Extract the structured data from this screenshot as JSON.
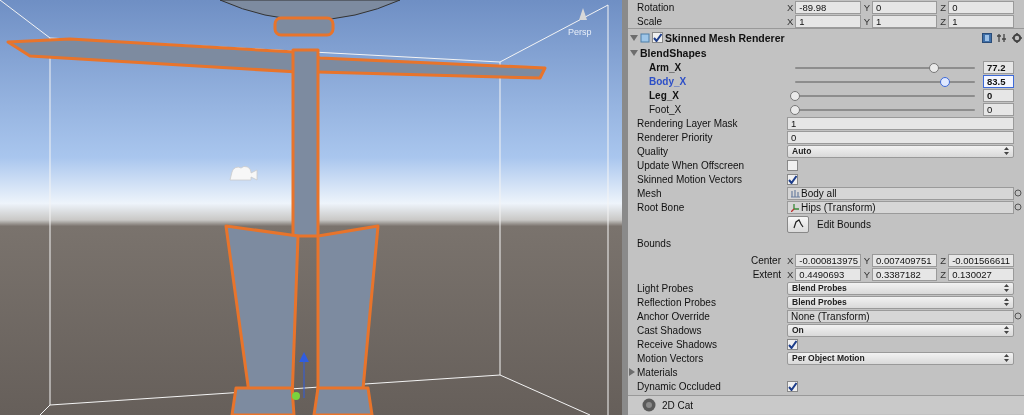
{
  "scene": {
    "view_label": "Persp"
  },
  "transform": [
    {
      "label": "Rotation",
      "fields": [
        {
          "axis": "X",
          "value": "-89.98"
        },
        {
          "axis": "Y",
          "value": "0"
        },
        {
          "axis": "Z",
          "value": "0"
        }
      ]
    },
    {
      "label": "Scale",
      "fields": [
        {
          "axis": "X",
          "value": "1"
        },
        {
          "axis": "Y",
          "value": "1"
        },
        {
          "axis": "Z",
          "value": "1"
        }
      ]
    }
  ],
  "component": {
    "title": "Skinned Mesh Renderer",
    "enabled": true,
    "expanded": true
  },
  "blend_shapes": {
    "label": "BlendShapes",
    "expanded": true,
    "items": [
      {
        "name": "Arm_X",
        "level": 0.772,
        "value": "77.2",
        "selected": false,
        "overridden": true
      },
      {
        "name": "Body_X",
        "level": 0.835,
        "value": "83.5",
        "selected": true,
        "overridden": true
      },
      {
        "name": "Leg_X",
        "level": 0,
        "value": "0",
        "selected": false,
        "overridden": true
      },
      {
        "name": "Foot_X",
        "level": 0,
        "value": "0",
        "selected": false,
        "overridden": false
      }
    ]
  },
  "properties": [
    {
      "kind": "text",
      "label": "Rendering Layer Mask",
      "value": "1"
    },
    {
      "kind": "text",
      "label": "Renderer Priority",
      "value": "0"
    },
    {
      "kind": "dropdown",
      "label": "Quality",
      "value": "Auto"
    },
    {
      "kind": "checkbox",
      "label": "Update When Offscreen",
      "checked": false
    },
    {
      "kind": "checkbox",
      "label": "Skinned Motion Vectors",
      "checked": true
    },
    {
      "kind": "mesh_object",
      "label": "Mesh",
      "value": "Body all"
    },
    {
      "kind": "bone_object",
      "label": "Root Bone",
      "value": "Hips (Transform)"
    },
    {
      "kind": "button",
      "value": "Edit Bounds"
    },
    {
      "kind": "header",
      "label": "Bounds"
    },
    {
      "kind": "vector",
      "label": "Center",
      "fields": [
        {
          "axis": "X",
          "value": "-0.000813975"
        },
        {
          "axis": "Y",
          "value": "0.007409751"
        },
        {
          "axis": "Z",
          "value": "-0.001566611"
        }
      ]
    },
    {
      "kind": "vector",
      "label": "Extent",
      "fields": [
        {
          "axis": "X",
          "value": "0.4490693"
        },
        {
          "axis": "Y",
          "value": "0.3387182"
        },
        {
          "axis": "Z",
          "value": "0.130027"
        }
      ]
    },
    {
      "kind": "dropdown",
      "label": "Light Probes",
      "value": "Blend Probes"
    },
    {
      "kind": "dropdown",
      "label": "Reflection Probes",
      "value": "Blend Probes"
    },
    {
      "kind": "object",
      "label": "Anchor Override",
      "value": "None (Transform)"
    },
    {
      "kind": "dropdown",
      "label": "Cast Shadows",
      "value": "On"
    },
    {
      "kind": "checkbox",
      "label": "Receive Shadows",
      "checked": true
    },
    {
      "kind": "dropdown",
      "label": "Motion Vectors",
      "value": "Per Object Motion"
    },
    {
      "kind": "foldout",
      "label": "Materials",
      "expanded": false
    },
    {
      "kind": "checkbox",
      "label": "Dynamic Occluded",
      "checked": true
    }
  ],
  "next_component": {
    "title": "2D Cat"
  }
}
